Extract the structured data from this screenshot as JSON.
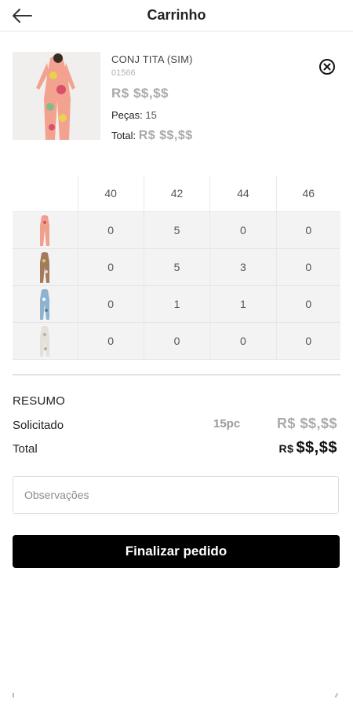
{
  "header": {
    "title": "Carrinho"
  },
  "product": {
    "name": "CONJ TITA (SIM)",
    "code": "01566",
    "price": "R$ $$,$$",
    "pieces_label": "Peças:",
    "pieces_value": "15",
    "total_label": "Total:",
    "total_value": "R$ $$,$$"
  },
  "grid": {
    "sizes": [
      "40",
      "42",
      "44",
      "46"
    ],
    "rows": [
      {
        "color": "pink-floral",
        "values": [
          "0",
          "5",
          "0",
          "0"
        ]
      },
      {
        "color": "brown-floral",
        "values": [
          "0",
          "5",
          "3",
          "0"
        ]
      },
      {
        "color": "blue-floral",
        "values": [
          "0",
          "1",
          "1",
          "0"
        ]
      },
      {
        "color": "white-floral",
        "values": [
          "0",
          "0",
          "0",
          "0"
        ]
      }
    ]
  },
  "resumo": {
    "title": "RESUMO",
    "solicitado_label": "Solicitado",
    "solicitado_qty": "15pc",
    "solicitado_value": "R$ $$,$$",
    "total_label": "Total",
    "total_currency": "R$",
    "total_value": "$$,$$"
  },
  "observacoes": {
    "placeholder": "Observações",
    "value": ""
  },
  "actions": {
    "finalize_label": "Finalizar pedido"
  },
  "colors": {
    "accent": "#000000",
    "muted": "#a9a9a9",
    "cell_bg": "#f3f3f3"
  }
}
